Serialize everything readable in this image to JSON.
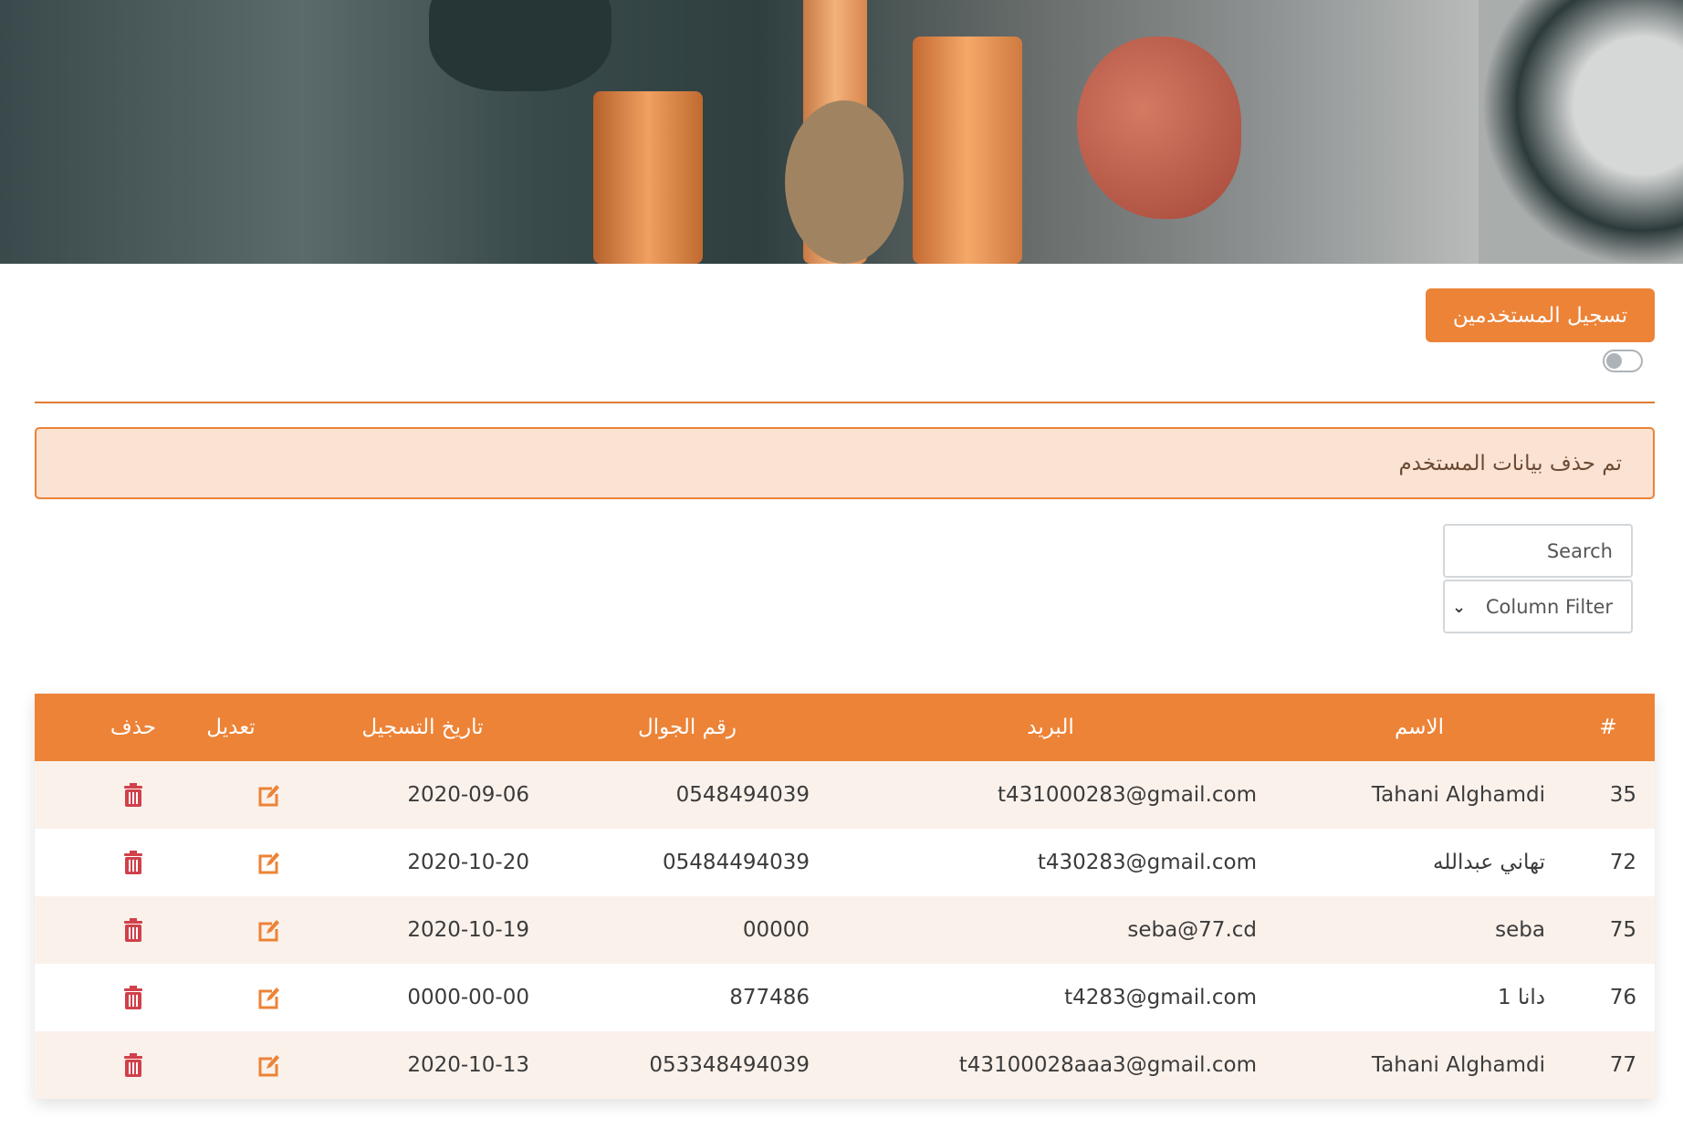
{
  "header": {
    "register_button": "تسجيل المستخدمين"
  },
  "alert": {
    "message": "تم حذف بيانات المستخدم"
  },
  "filters": {
    "search_placeholder": "Search",
    "column_filter": "Column Filter"
  },
  "colors": {
    "accent": "#EC8337",
    "alert_bg": "#FAE3D3",
    "delete": "#D0414B"
  },
  "table": {
    "headers": {
      "num": "#",
      "name": "الاسم",
      "email": "البريد",
      "phone": "رقم الجوال",
      "date": "تاريخ التسجيل",
      "edit": "تعديل",
      "delete": "حذف"
    },
    "rows": [
      {
        "num": "35",
        "name": "Tahani Alghamdi",
        "email": "t431000283@gmail.com",
        "phone": "0548494039",
        "date": "2020-09-06"
      },
      {
        "num": "72",
        "name": "تهاني عبدالله",
        "email": "t430283@gmail.com",
        "phone": "05484494039",
        "date": "2020-10-20"
      },
      {
        "num": "75",
        "name": "seba",
        "email": "seba@77.cd",
        "phone": "00000",
        "date": "2020-10-19"
      },
      {
        "num": "76",
        "name": "دانا 1",
        "email": "t4283@gmail.com",
        "phone": "877486",
        "date": "0000-00-00"
      },
      {
        "num": "77",
        "name": "Tahani Alghamdi",
        "email": "t43100028aaa3@gmail.com",
        "phone": "053348494039",
        "date": "2020-10-13"
      }
    ]
  }
}
